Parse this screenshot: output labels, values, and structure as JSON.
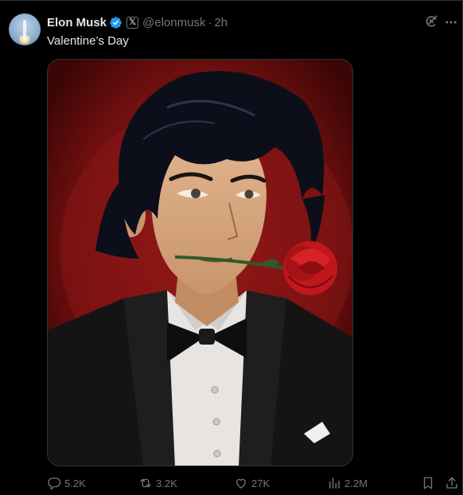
{
  "tweet": {
    "author_name": "Elon Musk",
    "handle": "@elonmusk",
    "separator": "·",
    "time": "2h",
    "badge": "𝕏",
    "text": "Valentine’s Day",
    "image_subject": "anime-man-with-rose-in-mouth"
  },
  "actions": {
    "replies": "5.2K",
    "reposts": "3.2K",
    "likes": "27K",
    "views": "2.2M"
  },
  "colors": {
    "background": "#000000",
    "text": "#e7e9ea",
    "muted": "#71767b",
    "verified": "#1d9bf0",
    "border": "#2f3336"
  },
  "icons": [
    "grok-icon",
    "more-icon",
    "reply-icon",
    "repost-icon",
    "like-icon",
    "views-icon",
    "bookmark-icon",
    "share-icon",
    "verified-icon"
  ]
}
